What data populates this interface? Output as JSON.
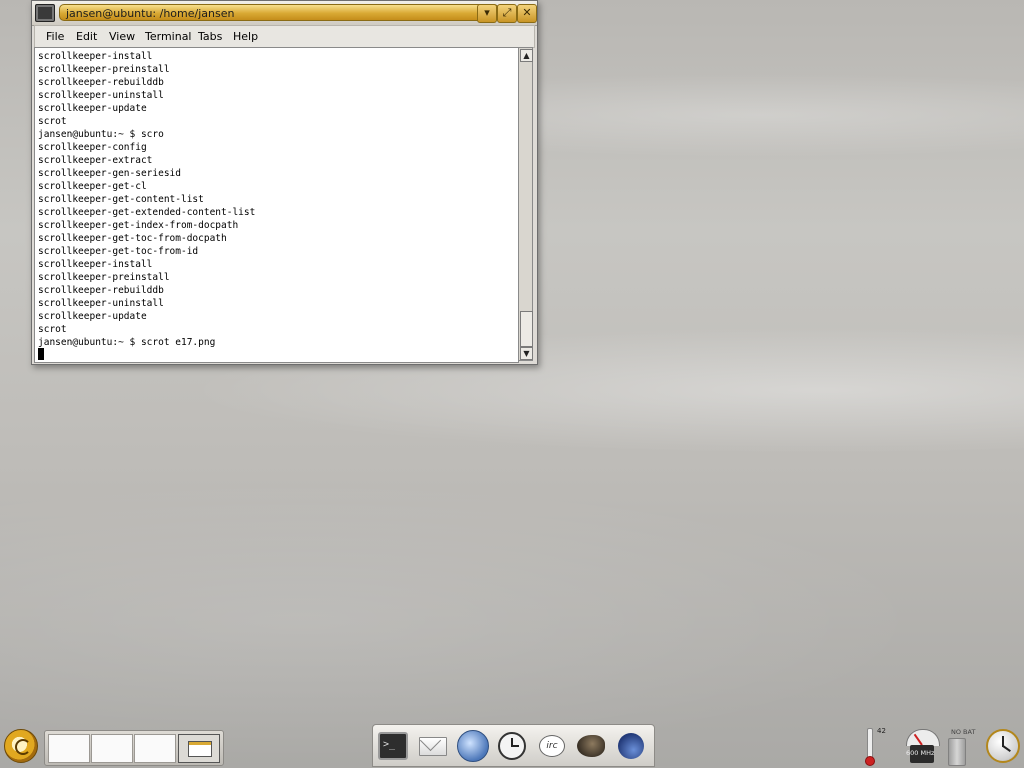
{
  "window": {
    "title": "jansen@ubuntu: /home/jansen",
    "accent": "#d9a934"
  },
  "menu": {
    "items": [
      {
        "label": "File"
      },
      {
        "label": "Edit"
      },
      {
        "label": "View"
      },
      {
        "label": "Terminal"
      },
      {
        "label": "Tabs"
      },
      {
        "label": "Help"
      }
    ]
  },
  "terminal": {
    "lines": [
      "scrollkeeper-install",
      "scrollkeeper-preinstall",
      "scrollkeeper-rebuilddb",
      "scrollkeeper-uninstall",
      "scrollkeeper-update",
      "scrot",
      "jansen@ubuntu:~ $ scro",
      "scrollkeeper-config",
      "scrollkeeper-extract",
      "scrollkeeper-gen-seriesid",
      "scrollkeeper-get-cl",
      "scrollkeeper-get-content-list",
      "scrollkeeper-get-extended-content-list",
      "scrollkeeper-get-index-from-docpath",
      "scrollkeeper-get-toc-from-docpath",
      "scrollkeeper-get-toc-from-id",
      "scrollkeeper-install",
      "scrollkeeper-preinstall",
      "scrollkeeper-rebuilddb",
      "scrollkeeper-uninstall",
      "scrollkeeper-update",
      "scrot",
      "jansen@ubuntu:~ $ scrot e17.png"
    ]
  },
  "dock": {
    "icons": [
      "terminal-icon",
      "mail-icon",
      "browser-icon",
      "clock-icon",
      "irc-icon",
      "gimp-icon",
      "audio-icon"
    ]
  },
  "tray": {
    "temperature": "42",
    "cpu": "600 MHz",
    "battery": "NO BAT"
  }
}
